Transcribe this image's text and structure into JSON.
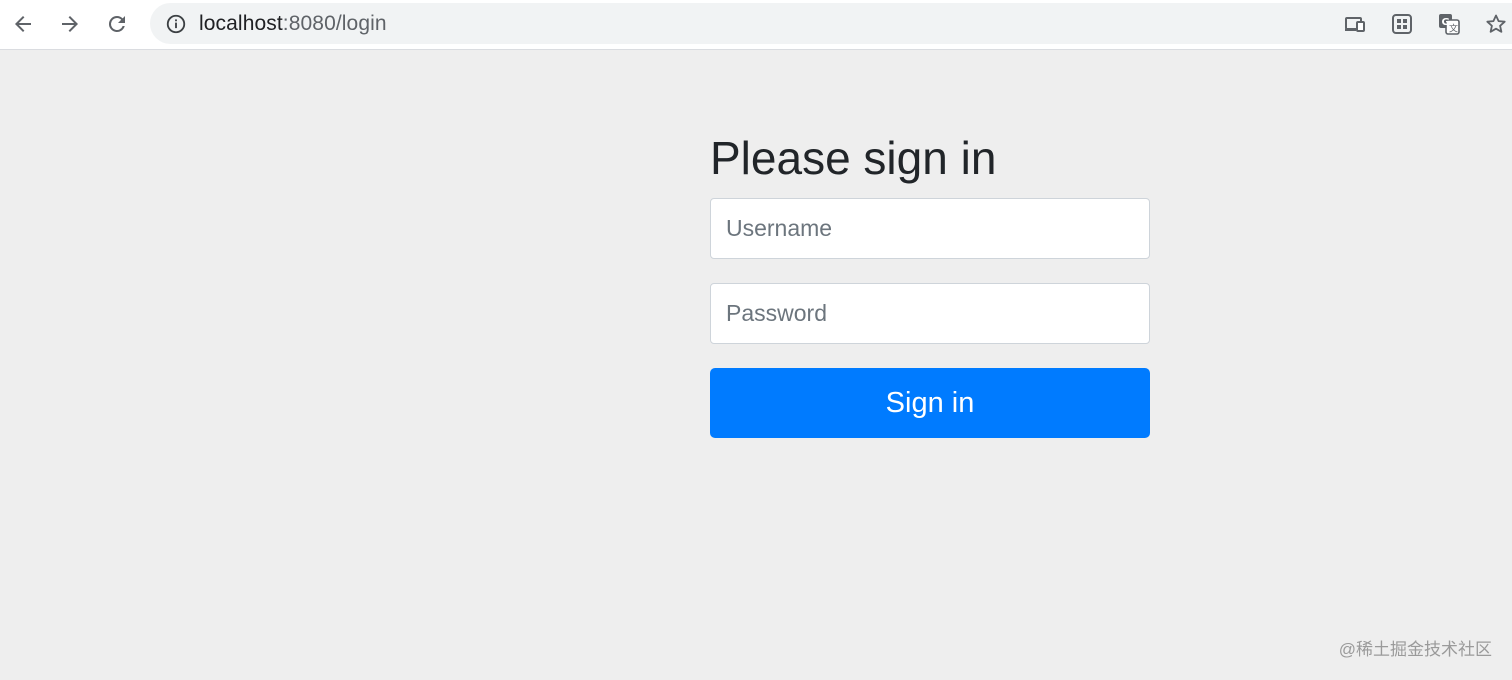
{
  "browser": {
    "url_host": "localhost",
    "url_path": ":8080/login",
    "icons": [
      "back-arrow-icon",
      "forward-arrow-icon",
      "reload-icon",
      "info-icon",
      "cast-icon",
      "qr-code-icon",
      "translate-icon",
      "bookmark-star-icon"
    ]
  },
  "login": {
    "heading": "Please sign in",
    "username_placeholder": "Username",
    "password_placeholder": "Password",
    "submit_label": "Sign in",
    "submit_color": "#007bff"
  },
  "watermark": "@稀土掘金技术社区"
}
